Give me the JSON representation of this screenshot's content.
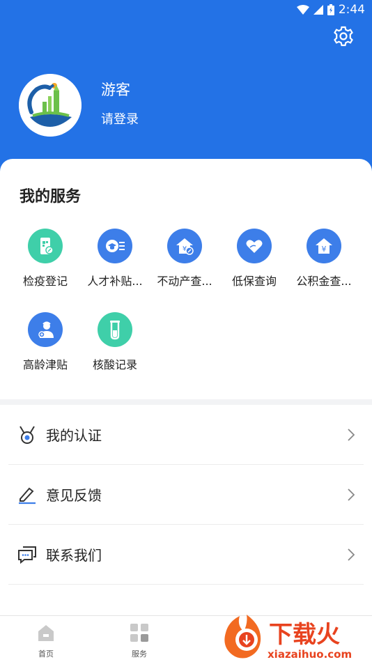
{
  "status_bar": {
    "time": "2:44"
  },
  "profile": {
    "name": "游客",
    "login_prompt": "请登录"
  },
  "services_title": "我的服务",
  "services": [
    {
      "label": "检疫登记",
      "color": "#3fcfa9",
      "icon": "phone-qr-icon"
    },
    {
      "label": "人才补贴...",
      "color": "#3d7ee9",
      "icon": "graduation-card-icon"
    },
    {
      "label": "不动产查...",
      "color": "#3d7ee9",
      "icon": "house-yen-icon"
    },
    {
      "label": "低保查询",
      "color": "#3d7ee9",
      "icon": "heart-hand-icon"
    },
    {
      "label": "公积金查...",
      "color": "#3d7ee9",
      "icon": "house-yen-icon"
    },
    {
      "label": "高龄津贴",
      "color": "#3d7ee9",
      "icon": "elderly-icon"
    },
    {
      "label": "核酸记录",
      "color": "#3fcfa9",
      "icon": "test-tube-icon"
    }
  ],
  "menu": [
    {
      "label": "我的认证",
      "icon": "medal-icon"
    },
    {
      "label": "意见反馈",
      "icon": "pencil-edit-icon"
    },
    {
      "label": "联系我们",
      "icon": "chat-icon"
    }
  ],
  "tabs": [
    {
      "label": "首页",
      "icon": "home-icon"
    },
    {
      "label": "服务",
      "icon": "grid-icon"
    }
  ],
  "watermark": {
    "brand": "下载火",
    "domain": "xiazaihuo.com"
  }
}
